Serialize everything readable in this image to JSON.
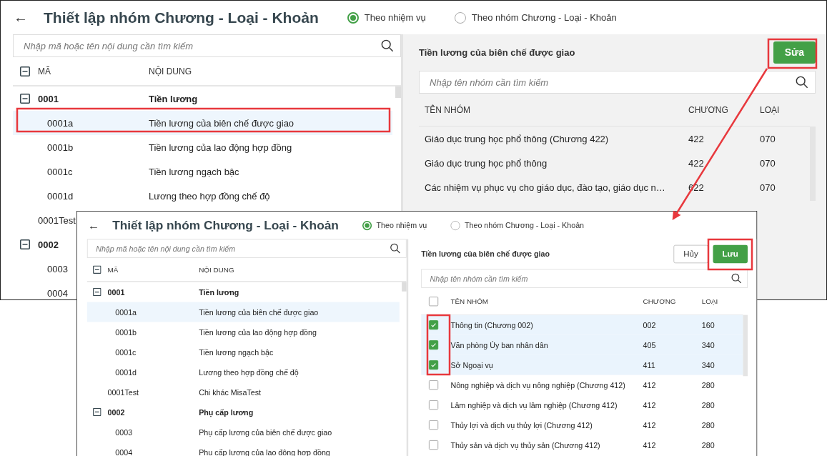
{
  "windows": [
    {
      "back_icon": "←",
      "title": "Thiết lập nhóm Chương - Loại - Khoản",
      "modes": [
        {
          "label": "Theo nhiệm vụ",
          "selected": true
        },
        {
          "label": "Theo nhóm Chương - Loại - Khoản",
          "selected": false
        }
      ],
      "tree": {
        "search": {
          "placeholder": "Nhập mã hoặc tên nội dung cần tìm kiếm"
        },
        "columns": [
          "MÃ",
          "NỘI DUNG"
        ],
        "items": [
          {
            "code": "0001",
            "content": "Tiền lương",
            "expanded": true,
            "selected": false,
            "children": [
              {
                "code": "0001a",
                "content": "Tiền lương của biên chế được giao",
                "selected": true
              },
              {
                "code": "0001b",
                "content": "Tiền lương của lao động hợp đồng",
                "selected": false
              },
              {
                "code": "0001c",
                "content": "Tiền lương ngạch bậc",
                "selected": false
              },
              {
                "code": "0001d",
                "content": "Lương theo hợp đồng chế độ",
                "selected": false
              }
            ]
          },
          {
            "code": "0001Test",
            "selected": false
          },
          {
            "code": "0002",
            "expanded": true,
            "selected": false,
            "children": [
              {
                "code": "0003",
                "selected": false
              },
              {
                "code": "0004",
                "selected": false
              }
            ]
          }
        ]
      },
      "detail": {
        "title": "Tiền lương của biên chế được giao",
        "editing": false,
        "buttons": [
          {
            "label": "Sửa",
            "kind": "primary"
          }
        ],
        "search": {
          "placeholder": "Nhập tên nhóm cần tìm kiếm"
        },
        "columns": [
          "TÊN NHÓM",
          "CHƯƠNG",
          "LOẠI"
        ],
        "rows": [
          {
            "name": "Giáo dục trung học phổ thông (Chương 422)",
            "chuong": "422",
            "loai": "070"
          },
          {
            "name": "Giáo dục trung học phổ thông",
            "chuong": "422",
            "loai": "070"
          },
          {
            "name": "Các nhiệm vụ phục vụ cho giáo dục, đào tạo, giáo dục n…",
            "chuong": "622",
            "loai": "070"
          }
        ]
      }
    },
    {
      "back_icon": "←",
      "title": "Thiết lập nhóm Chương - Loại - Khoản",
      "modes": [
        {
          "label": "Theo nhiệm vụ",
          "selected": true
        },
        {
          "label": "Theo nhóm Chương - Loại - Khoản",
          "selected": false
        }
      ],
      "tree": {
        "search": {
          "placeholder": "Nhập mã hoặc tên nội dung cần tìm kiếm"
        },
        "columns": [
          "MÃ",
          "NỘI DUNG"
        ],
        "items": [
          {
            "code": "0001",
            "content": "Tiền lương",
            "expanded": true,
            "selected": false,
            "children": [
              {
                "code": "0001a",
                "content": "Tiền lương của biên chế được giao",
                "selected": true
              },
              {
                "code": "0001b",
                "content": "Tiền lương của lao động hợp đồng",
                "selected": false
              },
              {
                "code": "0001c",
                "content": "Tiền lương ngạch bậc",
                "selected": false
              },
              {
                "code": "0001d",
                "content": "Lương theo hợp đồng chế độ",
                "selected": false
              }
            ]
          },
          {
            "code": "0001Test",
            "content": "Chi khác MisaTest",
            "selected": false
          },
          {
            "code": "0002",
            "content": "Phụ cấp lương",
            "expanded": true,
            "selected": false,
            "children": [
              {
                "code": "0003",
                "content": "Phụ cấp lương của biên chế được giao",
                "selected": false
              },
              {
                "code": "0004",
                "content": "Phụ cấp lương của lao động hợp đồng",
                "selected": false
              }
            ]
          }
        ]
      },
      "detail": {
        "title": "Tiền lương của biên chế được giao",
        "editing": true,
        "buttons": [
          {
            "label": "Hủy",
            "kind": "secondary"
          },
          {
            "label": "Lưu",
            "kind": "primary"
          }
        ],
        "search": {
          "placeholder": "Nhập tên nhóm cần tìm kiếm"
        },
        "columns": [
          "TÊN NHÓM",
          "CHƯƠNG",
          "LOẠI"
        ],
        "select_all": {
          "checked": false
        },
        "rows": [
          {
            "name": "Thông tin (Chương 002)",
            "chuong": "002",
            "loai": "160",
            "checked": true
          },
          {
            "name": "Văn phòng Ủy ban nhân dân",
            "chuong": "405",
            "loai": "340",
            "checked": true
          },
          {
            "name": "Sở Ngoại vụ",
            "chuong": "411",
            "loai": "340",
            "checked": true
          },
          {
            "name": "Nông nghiệp và dịch vụ nông nghiệp (Chương 412)",
            "chuong": "412",
            "loai": "280",
            "checked": false
          },
          {
            "name": "Lâm nghiệp và dịch vụ lâm nghiệp (Chương 412)",
            "chuong": "412",
            "loai": "280",
            "checked": false
          },
          {
            "name": "Thủy lợi và dịch vụ thủy lợi (Chương 412)",
            "chuong": "412",
            "loai": "280",
            "checked": false
          },
          {
            "name": "Thủy sản và dịch vụ thủy sản (Chương 412)",
            "chuong": "412",
            "loai": "280",
            "checked": false
          }
        ]
      }
    }
  ]
}
